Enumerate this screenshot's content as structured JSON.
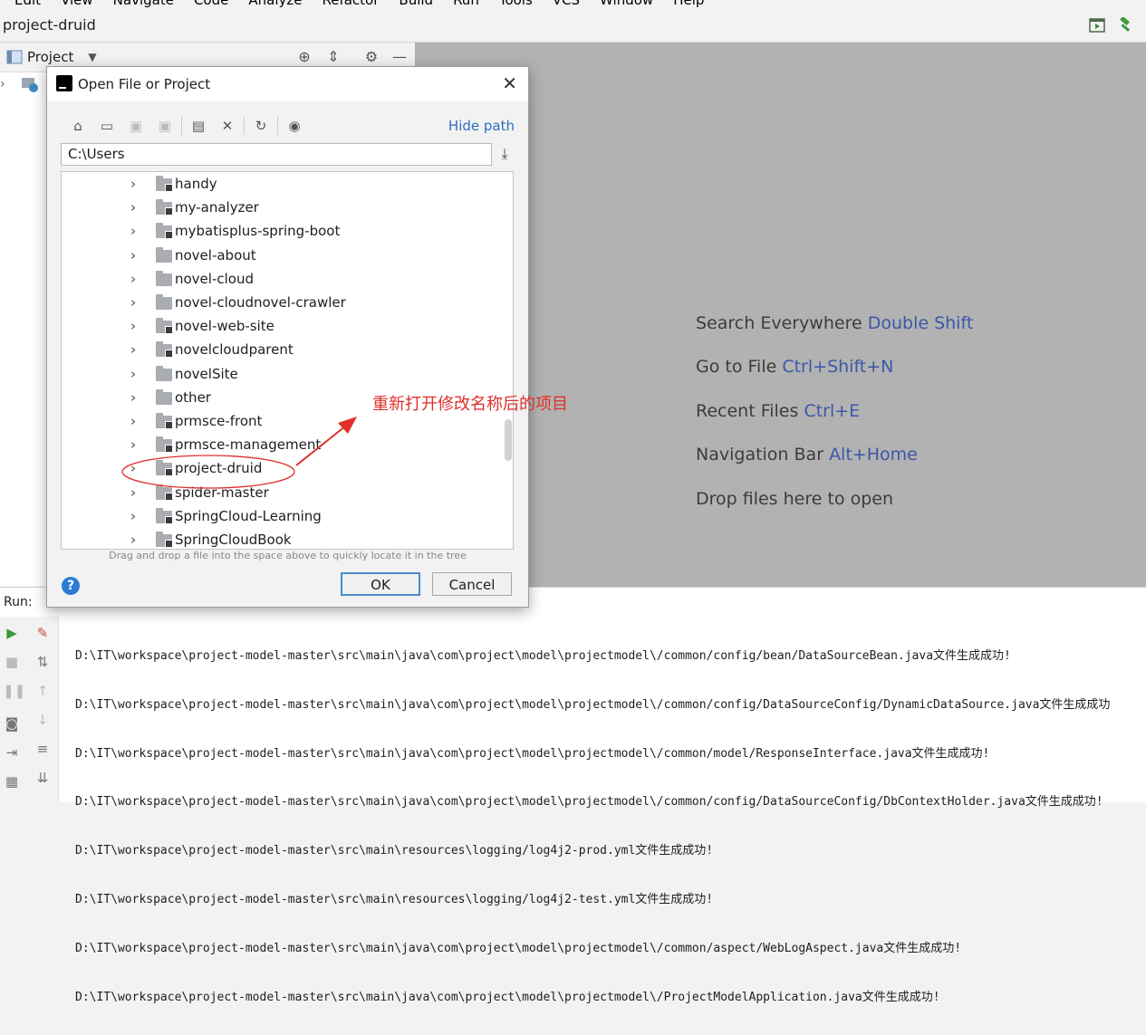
{
  "menu": [
    "Edit",
    "View",
    "Navigate",
    "Code",
    "Analyze",
    "Refactor",
    "Build",
    "Run",
    "Tools",
    "VCS",
    "Window",
    "Help"
  ],
  "window": {
    "title": "project-druid"
  },
  "project_panel": {
    "label": "Project"
  },
  "editor_hints": [
    {
      "text": "Search Everywhere",
      "key": "Double Shift"
    },
    {
      "text": "Go to File",
      "key": "Ctrl+Shift+N"
    },
    {
      "text": "Recent Files",
      "key": "Ctrl+E"
    },
    {
      "text": "Navigation Bar",
      "key": "Alt+Home"
    },
    {
      "text": "Drop files here to open",
      "key": ""
    }
  ],
  "dialog": {
    "title": "Open File or Project",
    "hide_path": "Hide path",
    "path": "C:\\Users",
    "dnd_hint": "Drag and drop a file into the space above to quickly locate it in the tree",
    "ok": "OK",
    "cancel": "Cancel",
    "help": "?",
    "tree": [
      {
        "name": "handy",
        "mod": true
      },
      {
        "name": "my-analyzer",
        "mod": true
      },
      {
        "name": "mybatisplus-spring-boot",
        "mod": true
      },
      {
        "name": "novel-about",
        "mod": false
      },
      {
        "name": "novel-cloud",
        "mod": false
      },
      {
        "name": "novel-cloudnovel-crawler",
        "mod": false
      },
      {
        "name": "novel-web-site",
        "mod": true
      },
      {
        "name": "novelcloudparent",
        "mod": true
      },
      {
        "name": "novelSite",
        "mod": false
      },
      {
        "name": "other",
        "mod": false
      },
      {
        "name": "prmsce-front",
        "mod": true
      },
      {
        "name": "prmsce-management",
        "mod": true
      },
      {
        "name": "project-druid",
        "mod": true
      },
      {
        "name": "spider-master",
        "mod": true
      },
      {
        "name": "SpringCloud-Learning",
        "mod": true
      },
      {
        "name": "SpringCloudBook",
        "mod": true
      }
    ]
  },
  "annotation": {
    "text": "重新打开修改名称后的项目",
    "color": "#e0302a"
  },
  "run": {
    "tab": "Run:",
    "lines": [
      "D:\\IT\\workspace\\project-model-master\\src\\main\\java\\com\\project\\model\\projectmodel\\/common/config/bean/DataSourceBean.java文件生成成功!",
      "D:\\IT\\workspace\\project-model-master\\src\\main\\java\\com\\project\\model\\projectmodel\\/common/config/DataSourceConfig/DynamicDataSource.java文件生成成功",
      "D:\\IT\\workspace\\project-model-master\\src\\main\\java\\com\\project\\model\\projectmodel\\/common/model/ResponseInterface.java文件生成成功!",
      "D:\\IT\\workspace\\project-model-master\\src\\main\\java\\com\\project\\model\\projectmodel\\/common/config/DataSourceConfig/DbContextHolder.java文件生成成功!",
      "D:\\IT\\workspace\\project-model-master\\src\\main\\resources\\logging/log4j2-prod.yml文件生成成功!",
      "D:\\IT\\workspace\\project-model-master\\src\\main\\resources\\logging/log4j2-test.yml文件生成成功!",
      "D:\\IT\\workspace\\project-model-master\\src\\main\\java\\com\\project\\model\\projectmodel\\/common/aspect/WebLogAspect.java文件生成成功!",
      "D:\\IT\\workspace\\project-model-master\\src\\main\\java\\com\\project\\model\\projectmodel\\/ProjectModelApplication.java文件生成成功!"
    ]
  }
}
